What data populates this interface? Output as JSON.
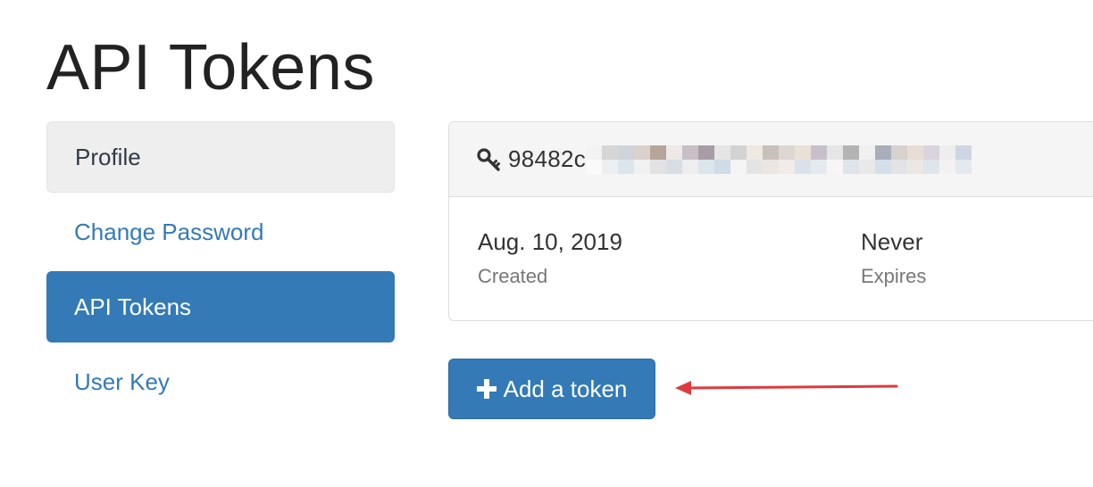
{
  "page": {
    "title": "API Tokens"
  },
  "sidebar": {
    "items": [
      {
        "label": "Profile",
        "state": "default"
      },
      {
        "label": "Change Password",
        "state": "link"
      },
      {
        "label": "API Tokens",
        "state": "active"
      },
      {
        "label": "User Key",
        "state": "link"
      }
    ]
  },
  "token": {
    "icon": "key-icon",
    "value_visible": "98482c",
    "value_redacted": true,
    "created_value": "Aug. 10, 2019",
    "created_label": "Created",
    "expires_value": "Never",
    "expires_label": "Expires"
  },
  "actions": {
    "add_token_label": "Add a token",
    "add_token_icon": "plus-icon"
  },
  "annotation": {
    "type": "arrow",
    "color": "#e0393e"
  },
  "colors": {
    "primary": "#337ab7",
    "panel_header": "#f5f5f5",
    "muted_text": "#777777"
  }
}
